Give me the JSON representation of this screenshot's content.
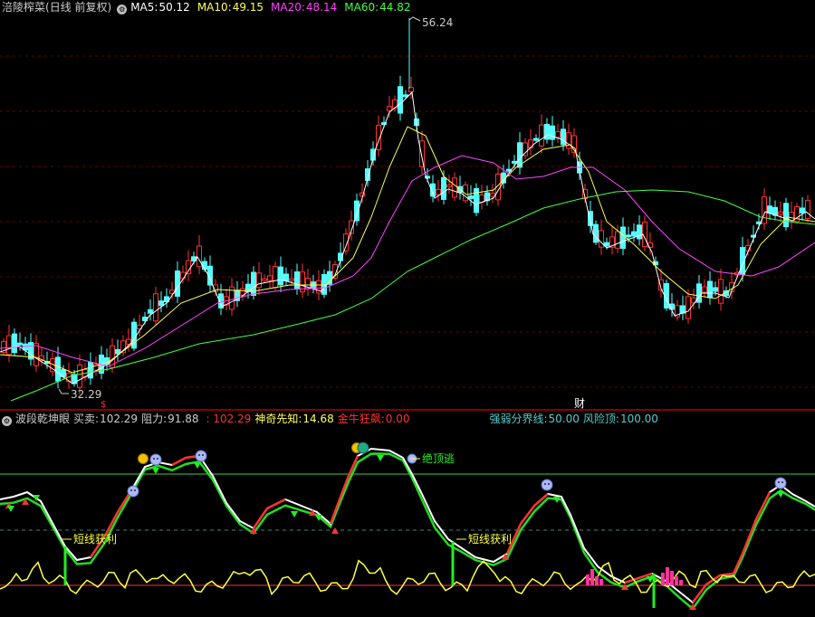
{
  "main": {
    "stock_name": "涪陵榨菜",
    "period": "(日线 前复权)",
    "ma": [
      {
        "label": "MA5:",
        "value": "50.12",
        "color": "#ffffff"
      },
      {
        "label": "MA10:",
        "value": "49.15",
        "color": "#ffff55"
      },
      {
        "label": "MA20:",
        "value": "48.14",
        "color": "#ff44ff"
      },
      {
        "label": "MA60:",
        "value": "44.82",
        "color": "#44ff44"
      }
    ],
    "high_label": "56.24",
    "low_label": "32.29",
    "dollar_marker": "$",
    "cai_marker": "财"
  },
  "indicator": {
    "name": "波段乾坤眼",
    "buy_sell_label": "买卖:",
    "buy_sell_value": "102.29",
    "resistance_label": "阻力:",
    "resistance_value": "91.88",
    "extra_value": ": 102.29",
    "shenqi_label": "神奇先知:",
    "shenqi_value": "14.68",
    "jinniu_label": "金牛狂飙:",
    "jinniu_value": "0.00",
    "strong_weak_label": "强弱分界线:",
    "strong_weak_value": "50.00",
    "risk_label": "风险顶:",
    "risk_value": "100.00",
    "annotations": [
      "短线获利",
      "短线获利",
      "绝顶逃"
    ]
  },
  "colors": {
    "up": "#ff3232",
    "down": "#54ffff",
    "bg": "#000000",
    "grid": "#8b0000"
  }
}
